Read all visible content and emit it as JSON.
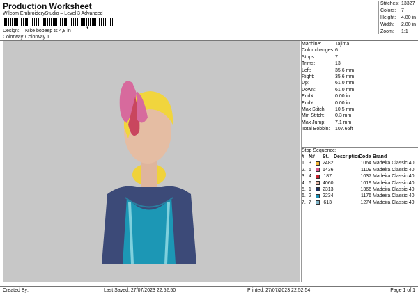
{
  "header": {
    "title": "Production Worksheet",
    "subtitle": "Wilcom EmbroideryStudio – Level 3 Advanced",
    "barcode_mark": ","
  },
  "design_info": [
    {
      "label": "Design:",
      "value": "Nike bobeep ts 4,8 in"
    },
    {
      "label": "Colorway:",
      "value": "Colorway 1"
    }
  ],
  "summary": [
    {
      "label": "Stitches:",
      "value": "13327"
    },
    {
      "label": "Colors:",
      "value": "7"
    },
    {
      "label": "Height:",
      "value": "4.80 in"
    },
    {
      "label": "Width:",
      "value": "2.80 in"
    },
    {
      "label": "Zoom:",
      "value": "1:1"
    }
  ],
  "machine": [
    {
      "label": "Machine:",
      "value": "Tajima"
    },
    {
      "label": "Color changes:",
      "value": "6"
    },
    {
      "label": "Stops:",
      "value": "7"
    },
    {
      "label": "Trims:",
      "value": "13"
    },
    {
      "label": "Left:",
      "value": "35.6 mm"
    },
    {
      "label": "Right:",
      "value": "35.6 mm"
    },
    {
      "label": "Up:",
      "value": "61.0 mm"
    },
    {
      "label": "Down:",
      "value": "61.0 mm"
    },
    {
      "label": "EndX:",
      "value": "0.00 in"
    },
    {
      "label": "EndY:",
      "value": "0.00 in"
    },
    {
      "label": "Max Stitch:",
      "value": "10.5 mm"
    },
    {
      "label": "Min Stitch:",
      "value": "0.3 mm"
    },
    {
      "label": "Max Jump:",
      "value": "7.1 mm"
    },
    {
      "label": "Total Bobbin:",
      "value": "107.66ft"
    }
  ],
  "stop_sequence": {
    "title": "Stop Sequence:",
    "headers": [
      "#",
      "N#",
      "St.",
      "Description",
      "Code",
      "Brand"
    ],
    "rows": [
      {
        "num": "1.",
        "n": "3",
        "color": "#f2b534",
        "st": "2482",
        "desc": "",
        "code": "1064",
        "brand": "Madeira Classic 40"
      },
      {
        "num": "2.",
        "n": "5",
        "color": "#d9548b",
        "st": "1436",
        "desc": "",
        "code": "1109",
        "brand": "Madeira Classic 40"
      },
      {
        "num": "3.",
        "n": "4",
        "color": "#c8202a",
        "st": "187",
        "desc": "",
        "code": "1037",
        "brand": "Madeira Classic 40"
      },
      {
        "num": "4.",
        "n": "6",
        "color": "#e8b7a6",
        "st": "4060",
        "desc": "",
        "code": "1019",
        "brand": "Madeira Classic 40"
      },
      {
        "num": "5.",
        "n": "1",
        "color": "#1f2f5e",
        "st": "2313",
        "desc": "",
        "code": "1366",
        "brand": "Madeira Classic 40"
      },
      {
        "num": "6.",
        "n": "2",
        "color": "#1a8fb5",
        "st": "2234",
        "desc": "",
        "code": "1176",
        "brand": "Madeira Classic 40"
      },
      {
        "num": "7.",
        "n": "7",
        "color": "#7fb5c9",
        "st": "613",
        "desc": "",
        "code": "1274",
        "brand": "Madeira Classic 40"
      }
    ]
  },
  "footer": {
    "created_by": "Created By:",
    "last_saved": "Last Saved: 27/07/2023 22.52.50",
    "printed": "Printed: 27/07/2023 22.52.54",
    "page": "Page 1 of 1"
  }
}
